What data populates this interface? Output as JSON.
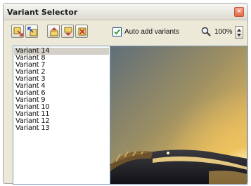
{
  "window": {
    "title": "Variant Selector"
  },
  "toolbar": {
    "auto_add_label": "Auto add variants",
    "auto_add_checked": true,
    "zoom_value": "100%"
  },
  "variants": [
    {
      "label": "Variant 14",
      "selected": true
    },
    {
      "label": "Variant 8"
    },
    {
      "label": "Variant 7"
    },
    {
      "label": "Variant 2"
    },
    {
      "label": "Variant 3"
    },
    {
      "label": "Variant 4"
    },
    {
      "label": "Variant 6"
    },
    {
      "label": "Variant 9"
    },
    {
      "label": "Variant 10"
    },
    {
      "label": "Variant 11"
    },
    {
      "label": "Variant 12"
    },
    {
      "label": "Variant 13"
    }
  ],
  "colors": {
    "window_bg": "#ece9d8",
    "selection": "#d4d0c8",
    "checkbox_border": "#1c5180"
  }
}
